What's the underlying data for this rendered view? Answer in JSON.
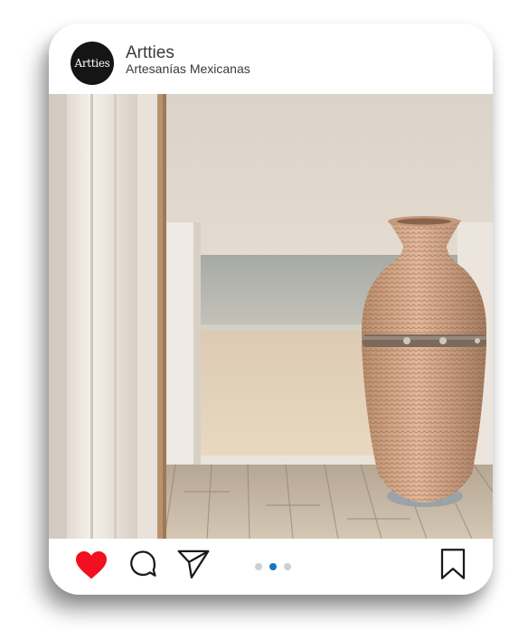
{
  "post": {
    "account_name": "Artties",
    "subtitle": "Artesanías Mexicanas",
    "avatar_text": "Artties"
  },
  "actions": {
    "like_icon": "heart-filled-icon",
    "comment_icon": "comment-bubble-icon",
    "share_icon": "paper-plane-icon",
    "save_icon": "bookmark-icon",
    "like_color": "#f20f1f"
  },
  "carousel": {
    "total": 3,
    "active_index": 1,
    "active_color": "#1875c2",
    "inactive_color": "#cfcfcf"
  }
}
